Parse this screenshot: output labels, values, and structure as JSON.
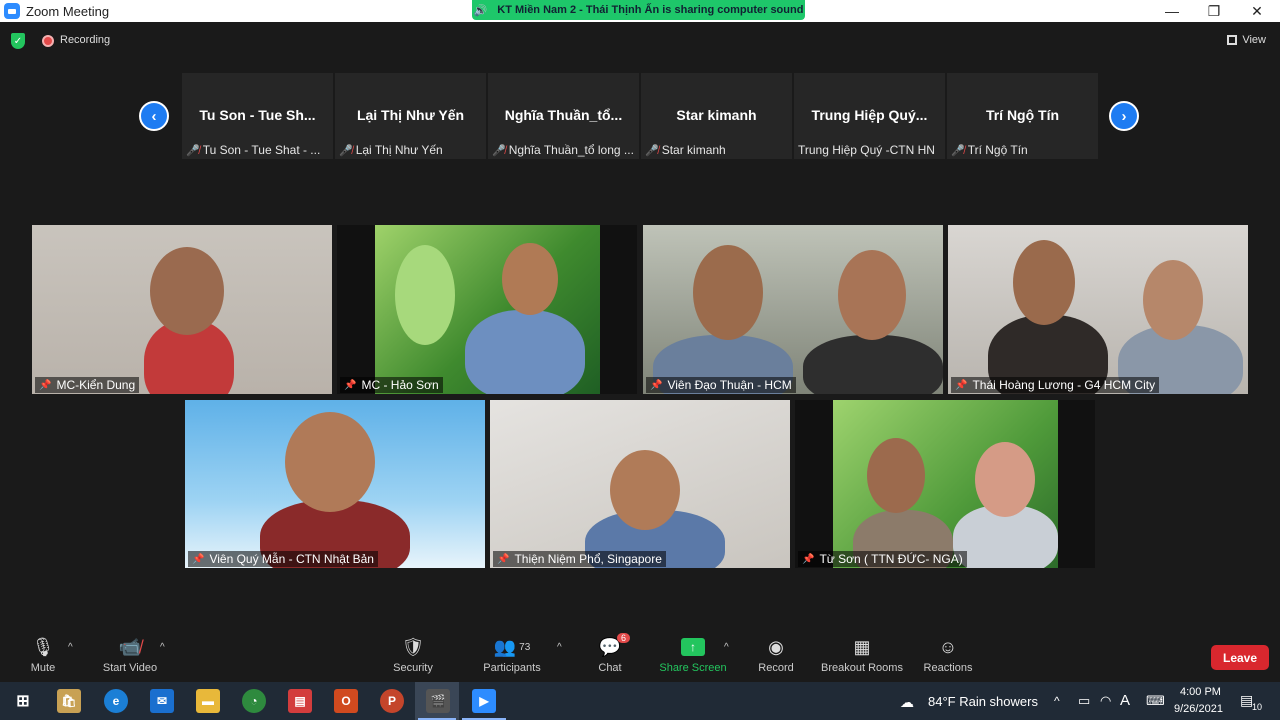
{
  "window": {
    "title": "Zoom Meeting",
    "share_banner": "KT Miền Nam 2 - Thái Thịnh Ấn is sharing computer sound",
    "minimize": "—",
    "maximize": "❐",
    "close": "✕"
  },
  "topbar": {
    "recording_label": "Recording",
    "view_label": "View"
  },
  "filmstrip": {
    "prev": "‹",
    "next": "›",
    "tiles": [
      {
        "display_name": "Tu Son - Tue Sh...",
        "name": "Tu Son - Tue Shat - ...",
        "muted": true
      },
      {
        "display_name": "Lại Thị Như Yến",
        "name": "Lại Thị Như Yến",
        "muted": true
      },
      {
        "display_name": "Nghĩa  Thuần_tổ...",
        "name": "Nghĩa  Thuần_tổ long ...",
        "muted": true
      },
      {
        "display_name": "Star kimanh",
        "name": "Star kimanh",
        "muted": true
      },
      {
        "display_name": "Trung  Hiệp  Quý...",
        "name": "Trung Hiệp Quý -CTN HN",
        "muted": false
      },
      {
        "display_name": "Trí Ngộ Tín",
        "name": "Trí Ngộ Tín",
        "muted": true
      }
    ]
  },
  "videos": [
    {
      "name": "MC-Kiển Dung"
    },
    {
      "name": "MC - Hảo Sơn"
    },
    {
      "name": "Viên Đạo Thuận - HCM"
    },
    {
      "name": "Thái Hoàng Lương - G4 HCM City"
    },
    {
      "name": "Viên Quý Mẫn - CTN Nhật Bản"
    },
    {
      "name": "Thiện Niệm Phổ, Singapore"
    },
    {
      "name": "Từ Sơn ( TTN ĐỨC- NGA)"
    }
  ],
  "toolbar": {
    "mute": "Mute",
    "start_video": "Start Video",
    "security": "Security",
    "participants": "Participants",
    "participants_count": "73",
    "chat": "Chat",
    "chat_badge": "6",
    "share_screen": "Share Screen",
    "record": "Record",
    "breakout_rooms": "Breakout Rooms",
    "reactions": "Reactions",
    "leave": "Leave"
  },
  "taskbar": {
    "weather": "84°F  Rain showers",
    "time": "4:00 PM",
    "date": "9/26/2021",
    "notifications": "10",
    "lang": "A"
  }
}
